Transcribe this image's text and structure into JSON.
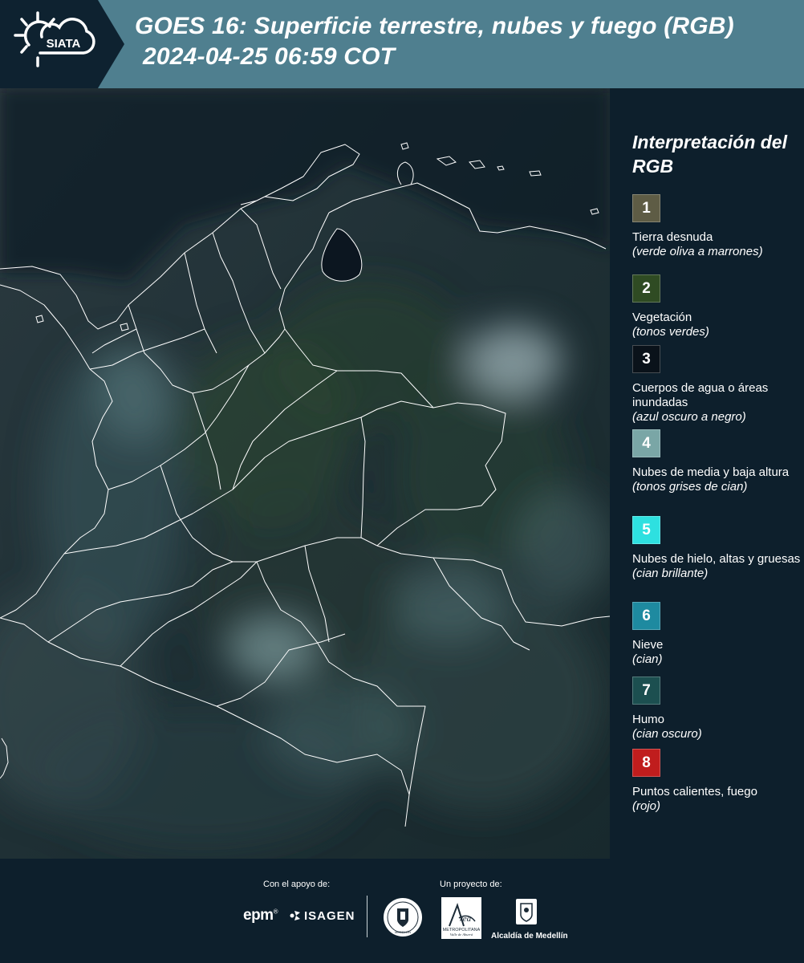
{
  "header": {
    "logo_text": "SIATA",
    "title_line1": "GOES 16: Superficie terrestre, nubes y fuego (RGB)",
    "title_line2": "2024-04-25 06:59 COT"
  },
  "legend": {
    "title": "Interpretación del RGB",
    "items": [
      {
        "number": "1",
        "label": "Tierra desnuda",
        "note": "(verde oliva a marrones)",
        "color": "#5e5c45"
      },
      {
        "number": "2",
        "label": "Vegetación",
        "note": "(tonos verdes)",
        "color": "#2f4b23"
      },
      {
        "number": "3",
        "label": "Cuerpos de agua o áreas inundadas",
        "note": "(azul oscuro a negro)",
        "color": "#0a121a"
      },
      {
        "number": "4",
        "label": "Nubes de media y baja altura",
        "note": "(tonos grises de cian)",
        "color": "#7aa6a6"
      },
      {
        "number": "5",
        "label": "Nubes de hielo, altas y gruesas",
        "note": "(cian brillante)",
        "color": "#2ee0e0"
      },
      {
        "number": "6",
        "label": "Nieve",
        "note": "(cian)",
        "color": "#1e8aa0"
      },
      {
        "number": "7",
        "label": "Humo",
        "note": "(cian oscuro)",
        "color": "#1c4f50"
      },
      {
        "number": "8",
        "label": "Puntos calientes, fuego",
        "note": "(rojo)",
        "color": "#c01d1d"
      }
    ]
  },
  "footer": {
    "support_label": "Con el apoyo de:",
    "project_label": "Un proyecto de:",
    "epm": "epm",
    "isagen": "ISAGEN",
    "area_logo_text": "Área METROPOLITANA Valle de Aburrá",
    "seal_text": "MEDELLÍN",
    "alcaldia": "Alcaldía de Medellín"
  }
}
